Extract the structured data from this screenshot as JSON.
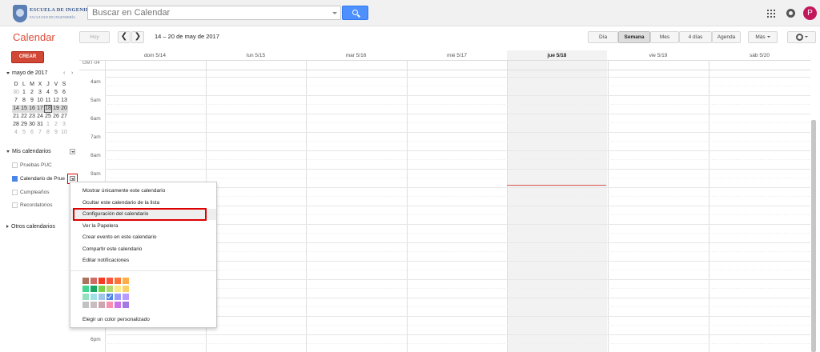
{
  "header": {
    "logo_line1": "ESCUELA DE INGENIERÍA",
    "logo_line2": "FACULTAD DE INGENIERÍA",
    "search_placeholder": "Buscar en Calendar",
    "avatar_letter": "P"
  },
  "toolbar": {
    "app_title": "Calendar",
    "today_label": "Hoy",
    "prev_label": "❮",
    "next_label": "❯",
    "date_range": "14 – 20 de may de 2017",
    "views": [
      "Día",
      "Semana",
      "Mes",
      "4 días",
      "Agenda"
    ],
    "active_view": "Semana",
    "more_label": "Más"
  },
  "sidebar": {
    "create_label": "CREAR",
    "mini_month": "mayo de 2017",
    "mini_prev": "‹",
    "mini_next": "›",
    "weekday_letters": [
      "D",
      "L",
      "M",
      "X",
      "J",
      "V",
      "S"
    ],
    "mini_weeks": [
      [
        "30",
        "1",
        "2",
        "3",
        "4",
        "5",
        "6"
      ],
      [
        "7",
        "8",
        "9",
        "10",
        "11",
        "12",
        "13"
      ],
      [
        "14",
        "15",
        "16",
        "17",
        "18",
        "19",
        "20"
      ],
      [
        "21",
        "22",
        "23",
        "24",
        "25",
        "26",
        "27"
      ],
      [
        "28",
        "29",
        "30",
        "31",
        "1",
        "2",
        "3"
      ],
      [
        "4",
        "5",
        "6",
        "7",
        "8",
        "9",
        "10"
      ]
    ],
    "my_calendars_label": "Mis calendarios",
    "my_calendars": [
      "Pruebas PUC",
      "Calendario de Prue",
      "Cumpleaños",
      "Recordatorios"
    ],
    "other_calendars_label": "Otros calendarios"
  },
  "calendar": {
    "timezone": "GMT-04",
    "days": [
      "dom 5/14",
      "lun 5/15",
      "mar 5/16",
      "mié 5/17",
      "jue 5/18",
      "vie 5/19",
      "sáb 5/20"
    ],
    "hours": [
      "4am",
      "5am",
      "6am",
      "7am",
      "8am",
      "9am",
      "",
      "",
      "",
      "",
      "",
      "",
      "",
      "",
      "6pm"
    ]
  },
  "context_menu": {
    "items": [
      "Mostrar únicamente este calendario",
      "Ocultar este calendario de la lista",
      "Configuración del calendario",
      "Ver la Papelera",
      "Crear evento en este calendario",
      "Compartir este calendario",
      "Editar notificaciones"
    ],
    "custom_color_label": "Elegir un color personalizado",
    "swatch_colors": [
      [
        "#ac725e",
        "#d06b64",
        "#f83a22",
        "#fa573c",
        "#ff7537",
        "#ffad46"
      ],
      [
        "#42d692",
        "#16a765",
        "#7bd148",
        "#b3dc6c",
        "#fbe983",
        "#fad165"
      ],
      [
        "#92e1c0",
        "#9fe1e7",
        "#9fc6e7",
        "#4986e7",
        "#9a9cff",
        "#b99aff"
      ],
      [
        "#c2c2c2",
        "#cabdbf",
        "#cca6ac",
        "#f691b2",
        "#cd74e6",
        "#a47ae2"
      ]
    ]
  }
}
